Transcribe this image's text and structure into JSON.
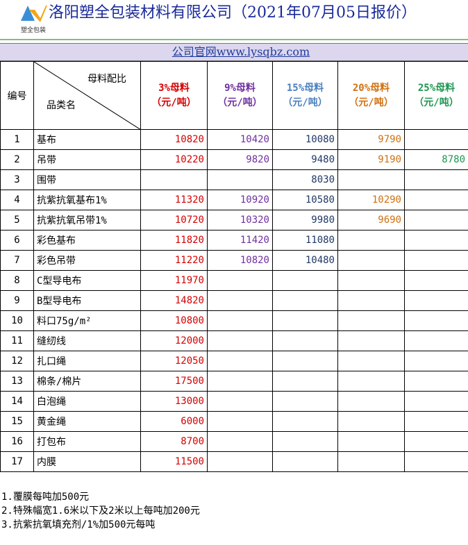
{
  "header": {
    "title": "洛阳塑全包装材料有限公司（2021年07月05日报价）",
    "logo_text": "塑全包装",
    "brand_color": "#1a2a9a"
  },
  "website": {
    "label": "公司官网www.lysqbz.com"
  },
  "table": {
    "id_header": "编号",
    "diag_top": "母料配比",
    "diag_bottom": "品类名",
    "columns": [
      {
        "pct": "3%母料",
        "unit": "（元/吨）",
        "color": "#d40000"
      },
      {
        "pct": "9%母料",
        "unit": "（元/吨）",
        "color": "#7030a0"
      },
      {
        "pct": "15%母料",
        "unit": "（元/吨）",
        "color": "#4a7fbf"
      },
      {
        "pct": "20%母料",
        "unit": "（元/吨）",
        "color": "#d07010"
      },
      {
        "pct": "25%母料",
        "unit": "（元/吨）",
        "color": "#1d9650"
      }
    ],
    "rows": [
      {
        "num": "1",
        "name": "基布",
        "v": [
          "10820",
          "10420",
          "10080",
          "9790",
          ""
        ]
      },
      {
        "num": "2",
        "name": "吊带",
        "v": [
          "10220",
          "9820",
          "9480",
          "9190",
          "8780"
        ]
      },
      {
        "num": "3",
        "name": "围带",
        "v": [
          "",
          "",
          "8030",
          "",
          ""
        ]
      },
      {
        "num": "4",
        "name": "抗紫抗氧基布1%",
        "v": [
          "11320",
          "10920",
          "10580",
          "10290",
          ""
        ]
      },
      {
        "num": "5",
        "name": "抗紫抗氧吊带1%",
        "v": [
          "10720",
          "10320",
          "9980",
          "9690",
          ""
        ]
      },
      {
        "num": "6",
        "name": "彩色基布",
        "v": [
          "11820",
          "11420",
          "11080",
          "",
          ""
        ]
      },
      {
        "num": "7",
        "name": "彩色吊带",
        "v": [
          "11220",
          "10820",
          "10480",
          "",
          ""
        ]
      },
      {
        "num": "8",
        "name": "C型导电布",
        "v": [
          "11970",
          "",
          "",
          "",
          ""
        ]
      },
      {
        "num": "9",
        "name": "B型导电布",
        "v": [
          "14820",
          "",
          "",
          "",
          ""
        ]
      },
      {
        "num": "10",
        "name": "料口75g/m²",
        "v": [
          "10800",
          "",
          "",
          "",
          ""
        ]
      },
      {
        "num": "11",
        "name": "缝纫线",
        "v": [
          "12000",
          "",
          "",
          "",
          ""
        ]
      },
      {
        "num": "12",
        "name": "扎口绳",
        "v": [
          "12050",
          "",
          "",
          "",
          ""
        ]
      },
      {
        "num": "13",
        "name": "棉条/棉片",
        "v": [
          "17500",
          "",
          "",
          "",
          ""
        ]
      },
      {
        "num": "14",
        "name": "白泡绳",
        "v": [
          "13000",
          "",
          "",
          "",
          ""
        ]
      },
      {
        "num": "15",
        "name": "黄金绳",
        "v": [
          "6000",
          "",
          "",
          "",
          ""
        ]
      },
      {
        "num": "16",
        "name": "打包布",
        "v": [
          "8700",
          "",
          "",
          "",
          ""
        ]
      },
      {
        "num": "17",
        "name": "内膜",
        "v": [
          "11500",
          "",
          "",
          "",
          ""
        ]
      }
    ]
  },
  "notes": [
    "1.覆膜每吨加500元",
    "2.特殊幅宽1.6米以下及2米以上每吨加200元",
    "3.抗紫抗氧填充剂/1%加500元每吨"
  ]
}
